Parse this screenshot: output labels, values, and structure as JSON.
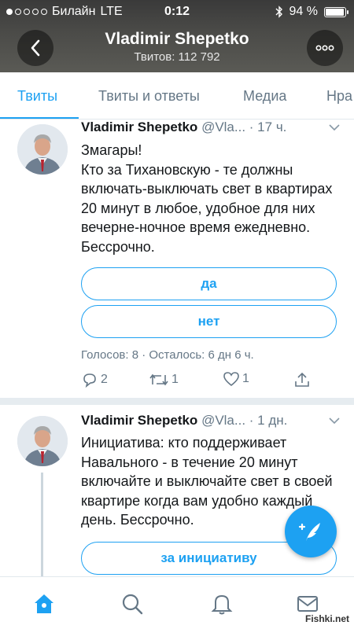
{
  "status_bar": {
    "carrier": "Билайн",
    "network": "LTE",
    "time": "0:12",
    "battery": "94 %",
    "battery_level": 0.94
  },
  "header": {
    "title": "Vladimir Shepetko",
    "subtitle": "Твитов: 112 792"
  },
  "tabs": [
    "Твиты",
    "Твиты и ответы",
    "Медиа",
    "Нра"
  ],
  "tweets": [
    {
      "name": "Vladimir Shepetko",
      "handle": "@Vla...",
      "time": "· 17 ч.",
      "text": "Змагары!\nКто за Тихановскую - те должны включать-выключать свет в квартирах 20 минут в любое, удобное для них вечерне-ночное время ежедневно. Бессрочно.",
      "poll_options": [
        "да",
        "нет"
      ],
      "poll_meta": "Голосов: 8 · Осталось: 6 дн 6 ч.",
      "replies": "2",
      "retweets": "1",
      "likes": "1"
    },
    {
      "name": "Vladimir Shepetko",
      "handle": "@Vla...",
      "time": "· 1 дн.",
      "text": "Инициатива: кто поддерживает Навального - в течение 20 минут включайте и выключайте свет в своей квартире когда вам удобно каждый день. Бессрочно.",
      "poll_options": [
        "за инициативу"
      ]
    }
  ],
  "watermark": "Fishki.net",
  "colors": {
    "accent": "#1da1f2",
    "secondary_text": "#657786",
    "divider": "#e6ecf0"
  },
  "icons": {
    "back": "chevron-left-icon",
    "more": "more-dots-icon",
    "caret": "chevron-down-icon",
    "reply": "reply-icon",
    "retweet": "retweet-icon",
    "like": "heart-icon",
    "share": "share-icon",
    "compose": "compose-feather-icon",
    "home": "home-icon",
    "search": "search-icon",
    "notifications": "bell-icon",
    "messages": "envelope-icon"
  }
}
